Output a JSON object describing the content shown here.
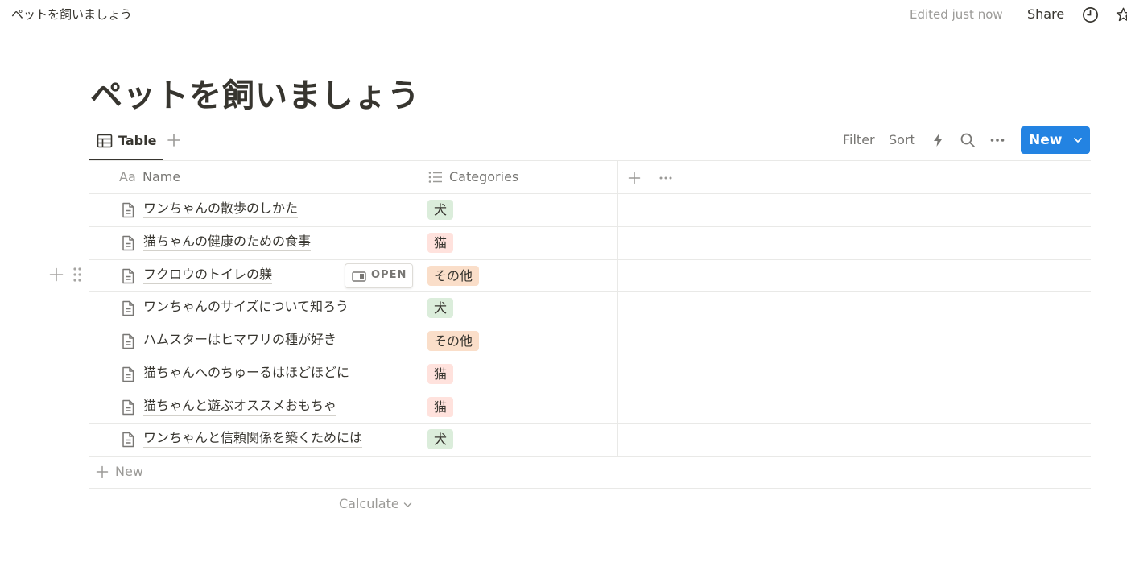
{
  "topbar": {
    "breadcrumb": "ペットを飼いましょう",
    "edited": "Edited just now",
    "share": "Share",
    "icons": [
      "clock-icon",
      "star-icon"
    ]
  },
  "page": {
    "title": "ペットを飼いましょう"
  },
  "view": {
    "tab_label": "Table",
    "tab_icon": "table-icon",
    "filter": "Filter",
    "sort": "Sort",
    "new_button": "New",
    "icons": [
      "plus-icon",
      "lightning-icon",
      "search-icon",
      "more-icon",
      "chevron-down-icon"
    ]
  },
  "table": {
    "columns": [
      {
        "icon": "text-aa-icon",
        "icon_text": "Aa",
        "label": "Name"
      },
      {
        "icon": "list-icon",
        "label": "Categories"
      }
    ],
    "rows": [
      {
        "name": "ワンちゃんの散歩のしかた",
        "category": "犬"
      },
      {
        "name": "猫ちゃんの健康のための食事",
        "category": "猫"
      },
      {
        "name": "フクロウのトイレの躾",
        "category": "その他"
      },
      {
        "name": "ワンちゃんのサイズについて知ろう",
        "category": "犬"
      },
      {
        "name": "ハムスターはヒマワリの種が好き",
        "category": "その他"
      },
      {
        "name": "猫ちゃんへのちゅーるはほどほどに",
        "category": "猫"
      },
      {
        "name": "猫ちゃんと遊ぶオススメおもちゃ",
        "category": "猫"
      },
      {
        "name": "ワンちゃんと信頼関係を築くためには",
        "category": "犬"
      }
    ],
    "hovered_row": 2,
    "open_label": "OPEN",
    "new_row": "New",
    "calculate": "Calculate"
  },
  "tag_colors": {
    "犬": "#dbeddb",
    "猫": "#ffe2dd",
    "その他": "#fadec9"
  },
  "colors": {
    "accent": "#2383e2",
    "text": "#37352f",
    "muted": "#787774",
    "border": "#e9e9e7"
  }
}
